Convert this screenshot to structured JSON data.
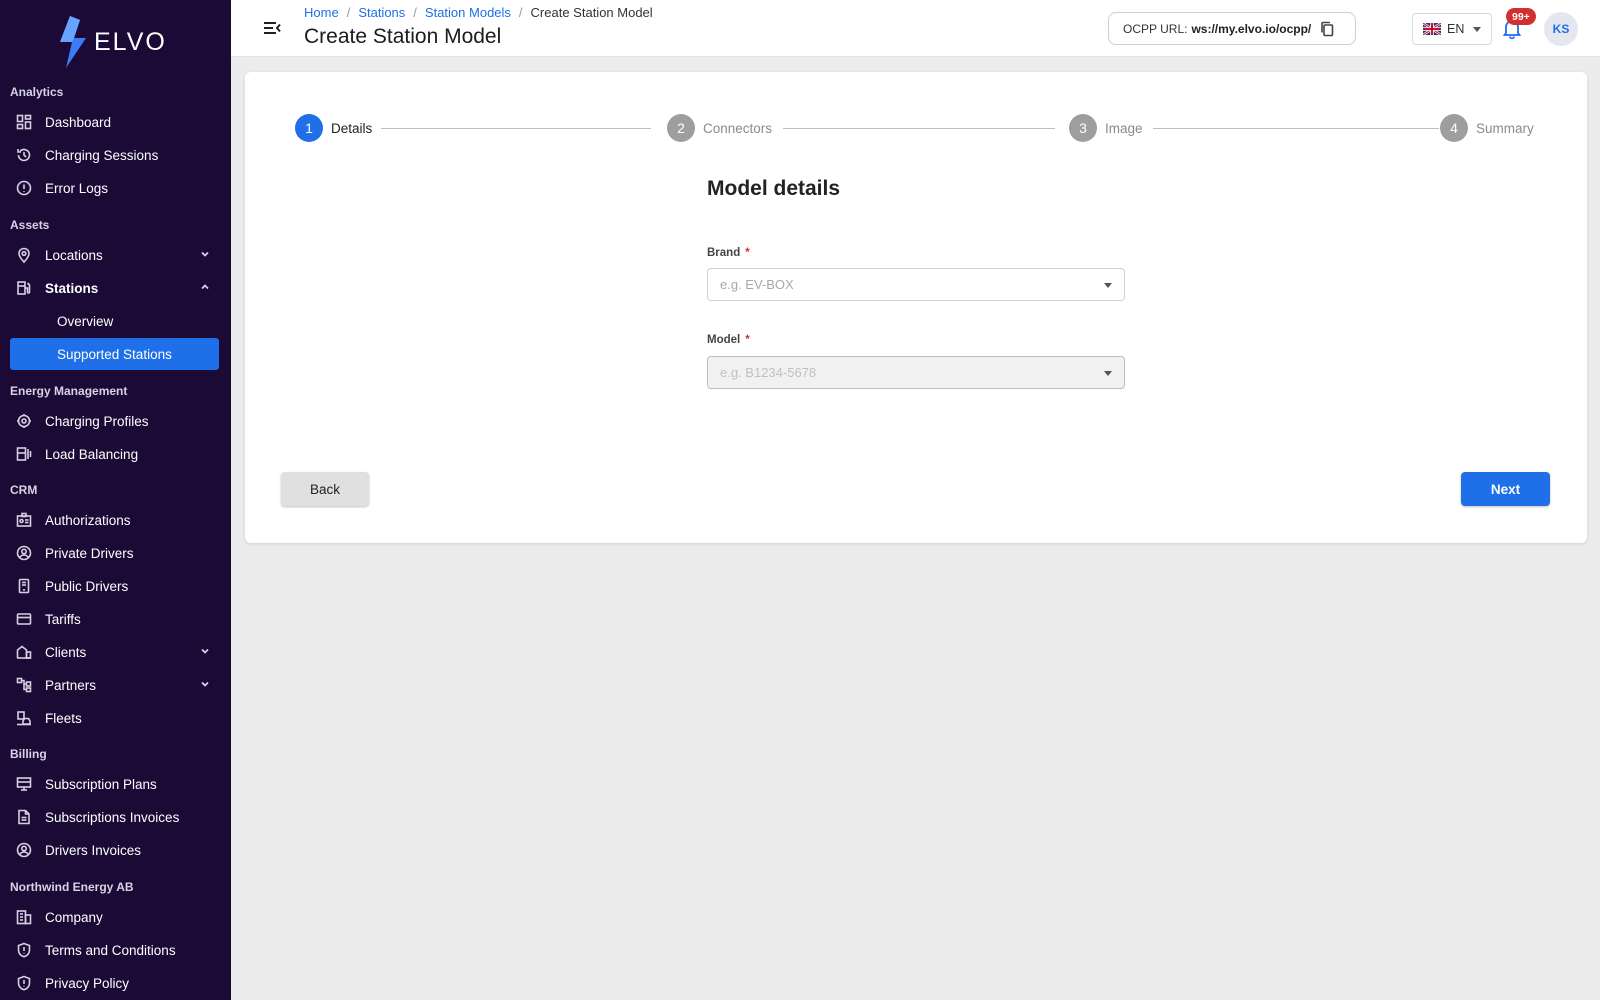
{
  "brand": {
    "name": "ELVO"
  },
  "sidebar": {
    "sections": {
      "analytics": "Analytics",
      "assets": "Assets",
      "energy": "Energy Management",
      "crm": "CRM",
      "billing": "Billing",
      "company": "Northwind Energy AB"
    },
    "items": {
      "dashboard": "Dashboard",
      "charging_sessions": "Charging Sessions",
      "error_logs": "Error Logs",
      "locations": "Locations",
      "stations": "Stations",
      "overview": "Overview",
      "supported_stations": "Supported Stations",
      "charging_profiles": "Charging Profiles",
      "load_balancing": "Load Balancing",
      "authorizations": "Authorizations",
      "private_drivers": "Private Drivers",
      "public_drivers": "Public Drivers",
      "tariffs": "Tariffs",
      "clients": "Clients",
      "partners": "Partners",
      "fleets": "Fleets",
      "subscription_plans": "Subscription Plans",
      "subscriptions_invoices": "Subscriptions Invoices",
      "drivers_invoices": "Drivers Invoices",
      "company": "Company",
      "terms": "Terms and Conditions",
      "privacy": "Privacy Policy"
    }
  },
  "header": {
    "breadcrumb": [
      "Home",
      "Stations",
      "Station Models",
      "Create Station Model"
    ],
    "separator": "/",
    "title": "Create Station Model",
    "ocpp_label": "OCPP URL:",
    "ocpp_url": "ws://my.elvo.io/ocpp/",
    "language": "EN",
    "notifications": "99+",
    "user_initials": "KS"
  },
  "stepper": [
    {
      "num": "1",
      "label": "Details"
    },
    {
      "num": "2",
      "label": "Connectors"
    },
    {
      "num": "3",
      "label": "Image"
    },
    {
      "num": "4",
      "label": "Summary"
    }
  ],
  "form": {
    "title": "Model details",
    "required_mark": "*",
    "brand_label": "Brand",
    "brand_placeholder": "e.g. EV-BOX",
    "model_label": "Model",
    "model_placeholder": "e.g. B1234-5678",
    "back_label": "Back",
    "next_label": "Next"
  },
  "colors": {
    "sidebar_bg": "#1a0a35",
    "accent": "#1f6fe8",
    "badge": "#d32f2f"
  }
}
